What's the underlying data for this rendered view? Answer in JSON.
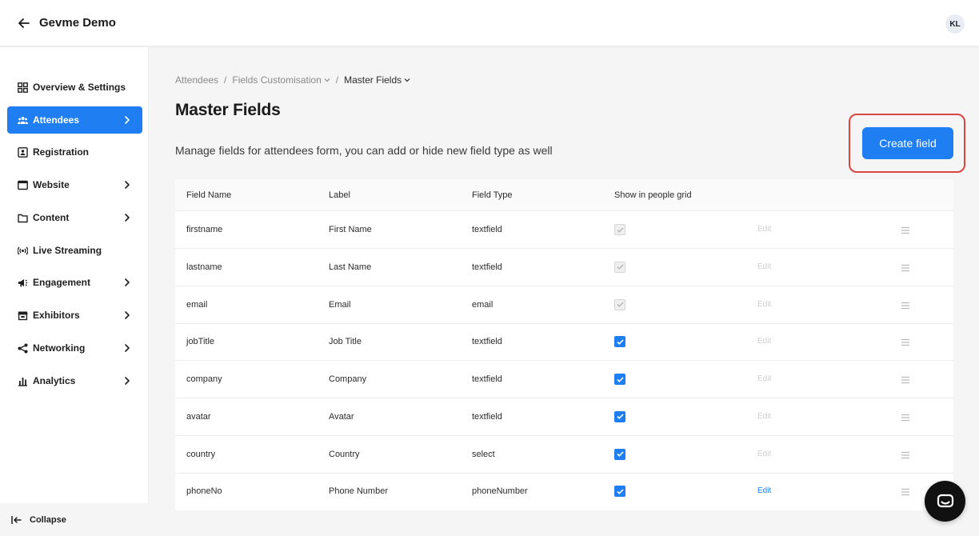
{
  "header": {
    "title": "Gevme Demo",
    "avatar_initials": "KL"
  },
  "sidebar": {
    "items": [
      {
        "label": "Overview & Settings",
        "icon": "grid-icon"
      },
      {
        "label": "Attendees",
        "icon": "people-icon"
      },
      {
        "label": "Registration",
        "icon": "badge-icon"
      },
      {
        "label": "Website",
        "icon": "window-icon"
      },
      {
        "label": "Content",
        "icon": "folder-icon"
      },
      {
        "label": "Live Streaming",
        "icon": "broadcast-icon"
      },
      {
        "label": "Engagement",
        "icon": "megaphone-icon"
      },
      {
        "label": "Exhibitors",
        "icon": "store-icon"
      },
      {
        "label": "Networking",
        "icon": "share-icon"
      },
      {
        "label": "Analytics",
        "icon": "bar-chart-icon"
      }
    ],
    "collapse_label": "Collapse"
  },
  "breadcrumb": {
    "first": "Attendees",
    "second": "Fields Customisation",
    "third": "Master Fields"
  },
  "page": {
    "title": "Master Fields",
    "description": "Manage fields for attendees form, you can add or hide new field type as well",
    "create_button": "Create field"
  },
  "table": {
    "columns": [
      "Field Name",
      "Label",
      "Field Type",
      "Show in people grid"
    ],
    "edit_label": "Edit",
    "rows": [
      {
        "name": "firstname",
        "label": "First Name",
        "type": "textfield",
        "show_in_grid": true,
        "locked": true
      },
      {
        "name": "lastname",
        "label": "Last Name",
        "type": "textfield",
        "show_in_grid": true,
        "locked": true
      },
      {
        "name": "email",
        "label": "Email",
        "type": "email",
        "show_in_grid": true,
        "locked": true
      },
      {
        "name": "jobTitle",
        "label": "Job Title",
        "type": "textfield",
        "show_in_grid": true,
        "locked": false
      },
      {
        "name": "company",
        "label": "Company",
        "type": "textfield",
        "show_in_grid": true,
        "locked": false
      },
      {
        "name": "avatar",
        "label": "Avatar",
        "type": "textfield",
        "show_in_grid": true,
        "locked": false
      },
      {
        "name": "country",
        "label": "Country",
        "type": "select",
        "show_in_grid": true,
        "locked": false
      },
      {
        "name": "phoneNo",
        "label": "Phone Number",
        "type": "phoneNumber",
        "show_in_grid": true,
        "locked": false,
        "edit_enabled": true
      }
    ]
  },
  "colors": {
    "accent": "#1f7ef2",
    "highlight_border": "#d9463f"
  }
}
